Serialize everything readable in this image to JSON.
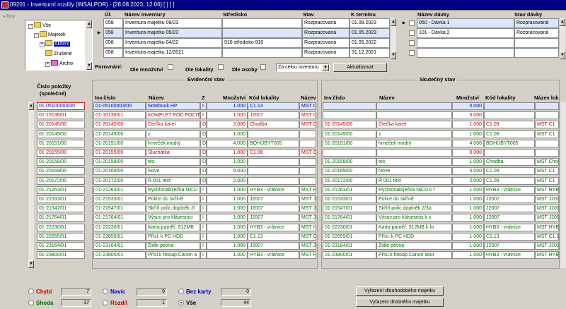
{
  "window": {
    "title": "09201 - Inventurní rozdíly (INSALPOR) - [28.08.2023; 12:06] [ ] [ ]"
  },
  "nav_label": "Nav",
  "tree": {
    "items": [
      "Vše",
      "Majetek",
      "Aktivní",
      "Zrušené",
      "Archiv"
    ]
  },
  "inventories": {
    "headers": [
      "Úl.",
      "Název inventury",
      "Středisko",
      "Stav",
      "K termínu"
    ],
    "rows": [
      {
        "ul": "058",
        "name": "Inventura majetku 08/23",
        "center": "",
        "state": "Rozpracovaná",
        "date": "01.08.2023"
      },
      {
        "ul": "058",
        "name": "Inventura majetku 05/23",
        "center": "",
        "state": "Rozpracovaná",
        "date": "01.05.2023"
      },
      {
        "ul": "058",
        "name": "Inventura majetku 04/22",
        "center": "910 středisko 910",
        "state": "Rozpracovaná",
        "date": "01.05.2022"
      },
      {
        "ul": "058",
        "name": "Inventura majetku 12/2021",
        "center": "",
        "state": "Rozpracovaná",
        "date": "31.12.2021"
      }
    ]
  },
  "batches": {
    "headers": [
      "Název dávky",
      "Stav dávky"
    ],
    "rows": [
      {
        "name": "050 - Dávka 1",
        "state": "Rozpracovaná"
      },
      {
        "name": "101 - Dávka 2",
        "state": "Rozpracovaná"
      }
    ]
  },
  "comparison": {
    "label": "Porovnání:",
    "by_qty": "Dle množství",
    "by_location": "Dle lokality",
    "by_person": "Dle osoby",
    "scope_value": "Za celou inventuru",
    "refresh_button": "Aktualizovat"
  },
  "items_column": {
    "header_line1": "Číslo položky",
    "header_line2": "(společné)"
  },
  "book_state": {
    "title": "Evidenční stav",
    "headers": [
      "Inv.číslo",
      "Název",
      "Z",
      "Množství",
      "Kód lokality",
      "Název"
    ]
  },
  "actual_state": {
    "title": "Skutečný stav",
    "headers": [
      "Inv.číslo",
      "Název",
      "Množství",
      "Kód lokality",
      "Název lok"
    ]
  },
  "rows": [
    {
      "color": "blue",
      "item": "01-05100003/00",
      "b_inv": "01-05100003/00",
      "b_name": "Notebook HP",
      "b_z": "I",
      "b_qty": "1.000",
      "b_loc": "C1.13",
      "b_locname": "MST C",
      "a_inv": "",
      "a_name": "",
      "a_qty": "0.000",
      "a_loc": "",
      "a_locname": ""
    },
    {
      "color": "red",
      "item": "01-15136/01",
      "b_inv": "01-15136/01",
      "b_name": "KOMPLET POD POCIT",
      "b_z": "I",
      "b_qty": "1.000",
      "b_loc": "J2007",
      "b_locname": "MST C",
      "a_inv": "",
      "a_name": "",
      "a_qty": "0.000",
      "a_loc": "",
      "a_locname": ""
    },
    {
      "color": "red",
      "item": "01-20145/00",
      "b_inv": "01-20145/00",
      "b_name": "Čtečka karet",
      "b_z": "D",
      "b_qty": "2.000",
      "b_loc": "Chodba",
      "b_locname": "MST C",
      "a_inv": "01-20145/00",
      "a_name": "Čtečka karet",
      "a_qty": "1.000",
      "a_loc": "C1.09",
      "a_locname": "MST C1"
    },
    {
      "color": "green",
      "item": "01-20149/00",
      "b_inv": "01-20149/00",
      "b_name": "x",
      "b_z": "D",
      "b_qty": "1.000",
      "b_loc": "",
      "b_locname": "",
      "a_inv": "01-20149/00",
      "a_name": "x",
      "a_qty": "1.000",
      "a_loc": "C1.08",
      "a_locname": "MST C1"
    },
    {
      "color": "green",
      "item": "01-20151/00",
      "b_inv": "01-20151/00",
      "b_name": "hrneček modrý",
      "b_z": "D",
      "b_qty": "4.000",
      "b_loc": "BOHUBYT005",
      "b_locname": "",
      "a_inv": "01-20151/00",
      "a_name": "hrneček modrý",
      "a_qty": "4.000",
      "a_loc": "BOHUBYT005",
      "a_locname": ""
    },
    {
      "color": "red",
      "item": "01-20155/00",
      "b_inv": "01-20155/00",
      "b_name": "Sluchátka",
      "b_z": "D",
      "b_qty": "1.000",
      "b_loc": "C1.08",
      "b_locname": "MST C",
      "a_inv": "",
      "a_name": "",
      "a_qty": "0.000",
      "a_loc": "",
      "a_locname": ""
    },
    {
      "color": "green",
      "item": "01-20158/00",
      "b_inv": "01-20158/00",
      "b_name": "tes",
      "b_z": "D",
      "b_qty": "1.000",
      "b_loc": "",
      "b_locname": "",
      "a_inv": "01-20158/00",
      "a_name": "tes",
      "a_qty": "1.000",
      "a_loc": "Chodba",
      "a_locname": "MST Chod"
    },
    {
      "color": "green",
      "item": "01-20169/00",
      "b_inv": "01-20169/00",
      "b_name": "Nove",
      "b_z": "D",
      "b_qty": "5.000",
      "b_loc": "",
      "b_locname": "",
      "a_inv": "01-20169/00",
      "a_name": "Nove",
      "a_qty": "5.000",
      "a_loc": "C1.09",
      "a_locname": "MST C1"
    },
    {
      "color": "green",
      "item": "01-20172/00",
      "b_inv": "01-20172/00",
      "b_name": "Ř 001 text",
      "b_z": "D",
      "b_qty": "2.000",
      "b_loc": "",
      "b_locname": "",
      "a_inv": "01-20172/00",
      "a_name": "Ř 001 text",
      "a_qty": "2.000",
      "a_loc": "C1.09",
      "a_locname": "MST C1"
    },
    {
      "color": "green",
      "item": "01-21263/01",
      "b_inv": "01-21263/01",
      "b_name": "Rychlonabíječka NiCD",
      "b_z": "I",
      "b_qty": "1.000",
      "b_loc": "HYB3 - vrátnice",
      "b_locname": "MST H",
      "a_inv": "01-21263/01",
      "a_name": "Rychlonabíječka NiCD k f",
      "a_qty": "1.000",
      "a_loc": "HYB3 - vrátnice",
      "a_locname": "MST HYB"
    },
    {
      "color": "green",
      "item": "01-21533/01",
      "b_inv": "01-21533/01",
      "b_name": "Police do skříně",
      "b_z": "I",
      "b_qty": "1.000",
      "b_loc": "J2007",
      "b_locname": "MST J",
      "a_inv": "01-21533/01",
      "a_name": "Police do skříně",
      "a_qty": "1.000",
      "a_loc": "J2007",
      "a_locname": "MST J200"
    },
    {
      "color": "green",
      "item": "01-21547/01",
      "b_inv": "01-21547/01",
      "b_name": "Skříň polic.doplněk 2/",
      "b_z": "I",
      "b_qty": "1.000",
      "b_loc": "J2007",
      "b_locname": "MST J",
      "a_inv": "01-21547/01",
      "a_name": "Skříň polic.doplněk 2/3a",
      "a_qty": "1.000",
      "a_loc": "J2007",
      "a_locname": "MST J200"
    },
    {
      "color": "green",
      "item": "01-21764/01",
      "b_inv": "01-21764/01",
      "b_name": "Výsuv pro klávesnici",
      "b_z": "I",
      "b_qty": "1.000",
      "b_loc": "J2007",
      "b_locname": "MST J",
      "a_inv": "01-21764/01",
      "a_name": "Výsuv pro klávesnici k s",
      "a_qty": "1.000",
      "a_loc": "J2007",
      "a_locname": "MST J200"
    },
    {
      "color": "green",
      "item": "01-22230/01",
      "b_inv": "01-22230/01",
      "b_name": "Karta paměť. 512MB",
      "b_z": "I",
      "b_qty": "1.000",
      "b_loc": "HYB3 - vrátnice",
      "b_locname": "MST H",
      "a_inv": "01-22230/01",
      "a_name": "Karta paměť. 512MB k fo",
      "a_qty": "1.000",
      "a_loc": "HYB3 - vrátnice",
      "a_locname": "MST HYB"
    },
    {
      "color": "green",
      "item": "01-22655/01",
      "b_inv": "01-22655/01",
      "b_name": "Přísl. k PC HDD",
      "b_z": "I",
      "b_qty": "1.000",
      "b_loc": "C1.13",
      "b_locname": "MST C",
      "a_inv": "01-22655/01",
      "a_name": "Přísl. k PC HDD",
      "a_qty": "1.000",
      "a_loc": "C1.13",
      "a_locname": "MST C1.1"
    },
    {
      "color": "green",
      "item": "01-23164/01",
      "b_inv": "01-23164/01",
      "b_name": "Židle pevná",
      "b_z": "I",
      "b_qty": "1.000",
      "b_loc": "J2007",
      "b_locname": "MST J",
      "a_inv": "01-23164/01",
      "a_name": "Židle pevná",
      "a_qty": "1.000",
      "a_loc": "J2007",
      "a_locname": "MST J200"
    },
    {
      "color": "green",
      "item": "01-23800/01",
      "b_inv": "01-23800/01",
      "b_name": "Přísl.k fotoap.Canon a",
      "b_z": "I",
      "b_qty": "1.000",
      "b_loc": "HYB3 - vrátnice",
      "b_locname": "MST H",
      "a_inv": "01-23800/01",
      "a_name": "Přísl.k fotoap.Canon akur",
      "a_qty": "1.000",
      "a_loc": "HYB3 - vrátnice",
      "a_locname": "MST HYB"
    }
  ],
  "filters": {
    "errors": {
      "label": "Chybí",
      "count": "7",
      "color": "#c00000"
    },
    "match": {
      "label": "Shoda",
      "count": "37",
      "color": "#007000"
    },
    "surplus": {
      "label": "Navíc",
      "count": "0",
      "color": "#0000c0"
    },
    "diff": {
      "label": "Rozdíl",
      "count": "1",
      "color": "#c00000"
    },
    "no_card": {
      "label": "Bez karty",
      "count": "0",
      "color": "#0000c0"
    },
    "all": {
      "label": "Vše",
      "count": "44",
      "color": "#000000"
    }
  },
  "actions": {
    "long_term": "Vyřazení dlouhodobého majetku",
    "small": "Vyřazení drobného majetku"
  },
  "colors": {
    "red": "#c00000",
    "green": "#007000",
    "blue": "#000080"
  }
}
